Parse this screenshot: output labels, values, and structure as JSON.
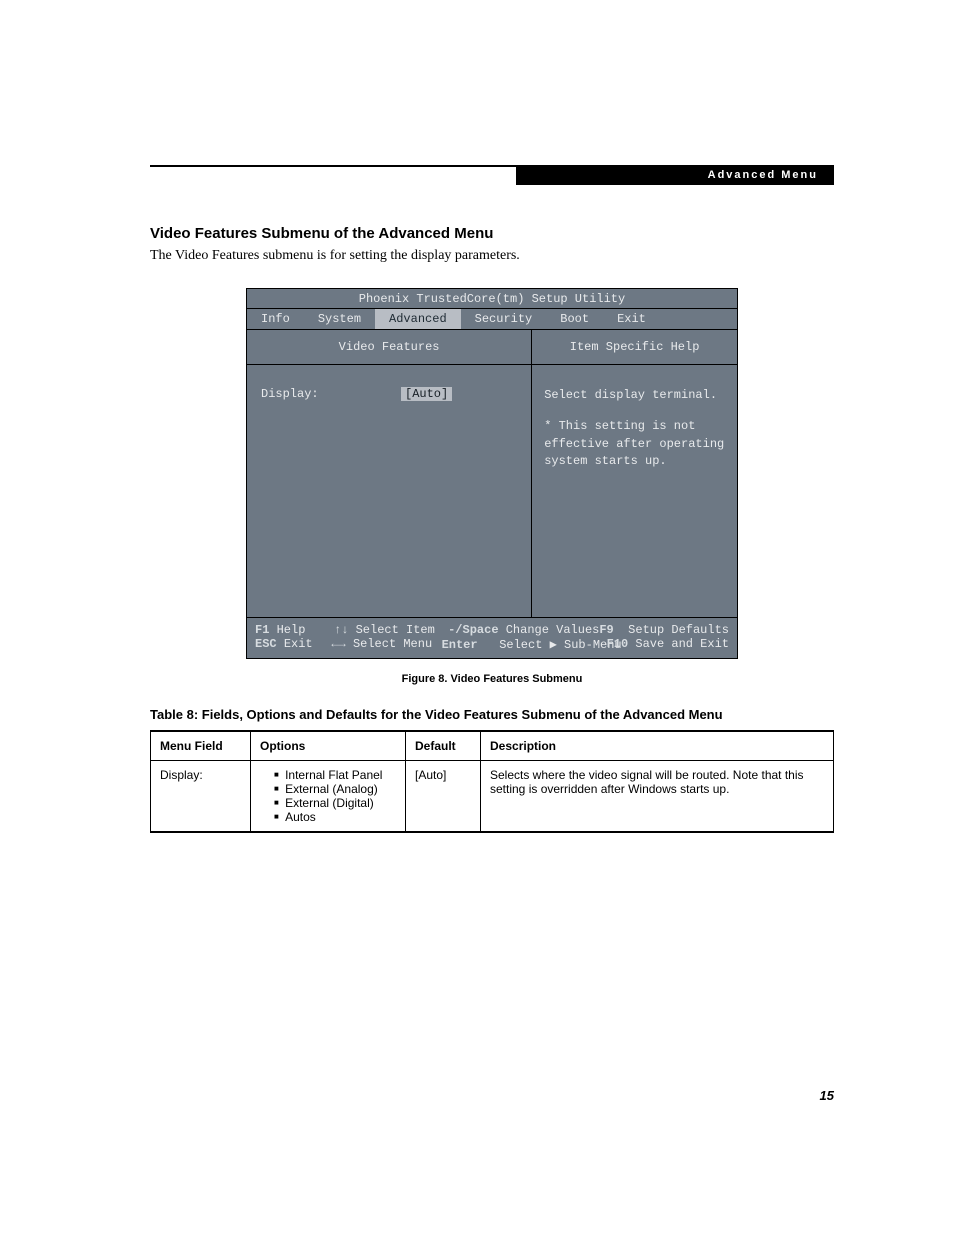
{
  "header": {
    "chip_label": "Advanced Menu"
  },
  "section": {
    "heading": "Video Features Submenu of the Advanced Menu",
    "intro": "The Video Features submenu is for setting the display parameters."
  },
  "bios": {
    "title": "Phoenix TrustedCore(tm) Setup Utility",
    "tabs": [
      "Info",
      "System",
      "Advanced",
      "Security",
      "Boot",
      "Exit"
    ],
    "selected_tab_index": 2,
    "left_title": "Video Features",
    "right_title": "Item Specific Help",
    "field": {
      "label": "Display:",
      "value": "[Auto]"
    },
    "help_line1": "Select display terminal.",
    "help_line2": "* This setting is not effective after operating system starts up.",
    "footer": {
      "row1": [
        {
          "key": "F1",
          "text": "Help"
        },
        {
          "key": "↑↓",
          "text": "Select Item"
        },
        {
          "key": "-/Space",
          "text": "Change Values"
        },
        {
          "key": "F9",
          "text": "Setup Defaults"
        }
      ],
      "row2": [
        {
          "key": "ESC",
          "text": "Exit"
        },
        {
          "key": "←→",
          "text": "Select Menu"
        },
        {
          "key": "Enter",
          "text": "Select ▶ Sub-Menu"
        },
        {
          "key": "F10",
          "text": "Save and Exit"
        }
      ]
    }
  },
  "figure_caption": "Figure 8.  Video Features Submenu",
  "table": {
    "caption": "Table 8: Fields, Options and Defaults for the Video Features Submenu of the Advanced Menu",
    "headers": [
      "Menu Field",
      "Options",
      "Default",
      "Description"
    ],
    "row": {
      "menu_field": "Display:",
      "options": [
        "Internal Flat Panel",
        "External (Analog)",
        "External (Digital)",
        "Autos"
      ],
      "default": "[Auto]",
      "description": "Selects where the video signal will be routed. Note that this setting is overridden after Windows starts up."
    }
  },
  "page_number": "15"
}
